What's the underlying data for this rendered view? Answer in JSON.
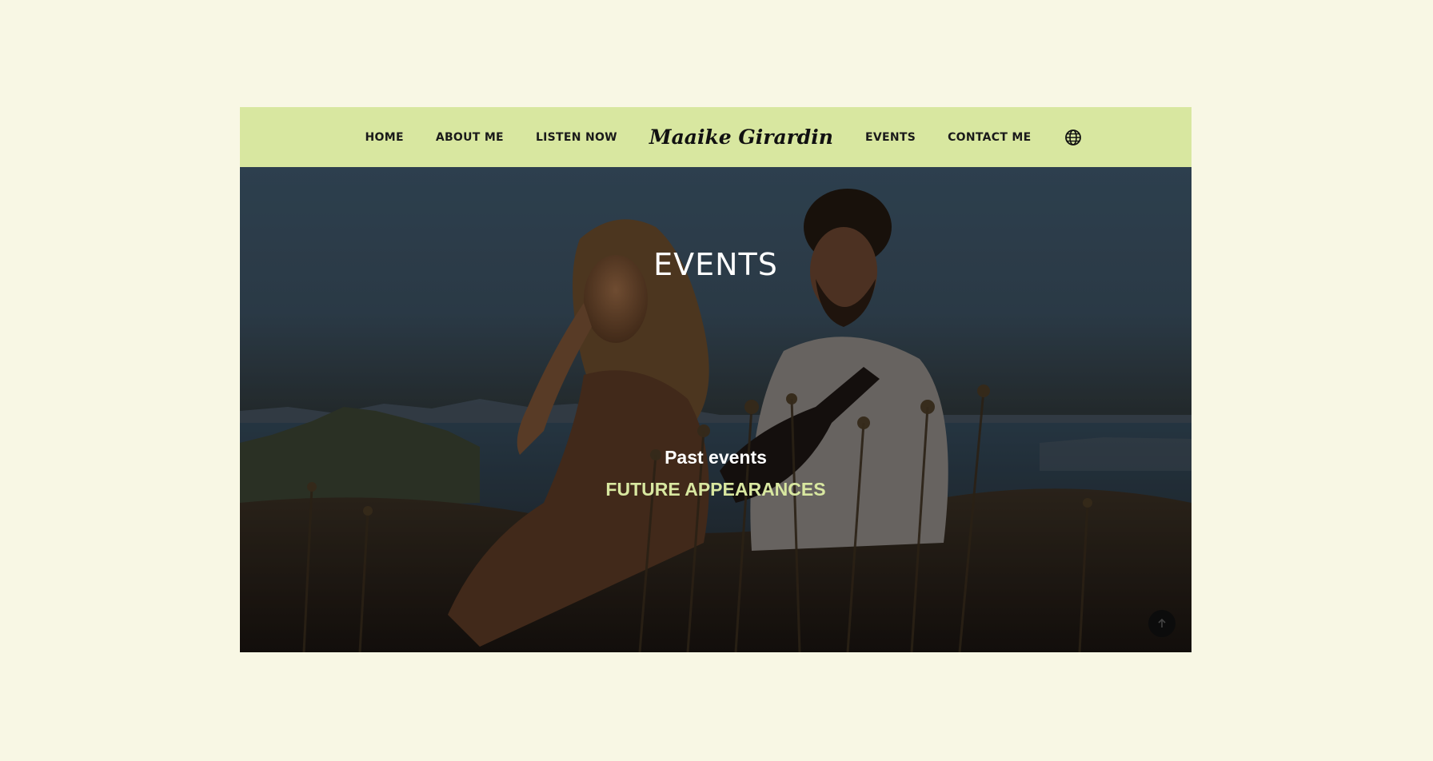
{
  "nav": {
    "items_left": [
      "HOME",
      "ABOUT ME",
      "LISTEN NOW"
    ],
    "brand": "Maaike Girardin",
    "items_right": [
      "EVENTS",
      "CONTACT ME"
    ],
    "language_icon": "globe-icon"
  },
  "hero": {
    "title": "EVENTS",
    "tabs": {
      "past": "Past events",
      "future": "FUTURE APPEARANCES"
    },
    "scroll_top_icon": "arrow-up-icon"
  },
  "colors": {
    "page_background": "#f8f7e4",
    "nav_background": "#d8e7a0",
    "accent": "#d8e7a0"
  }
}
